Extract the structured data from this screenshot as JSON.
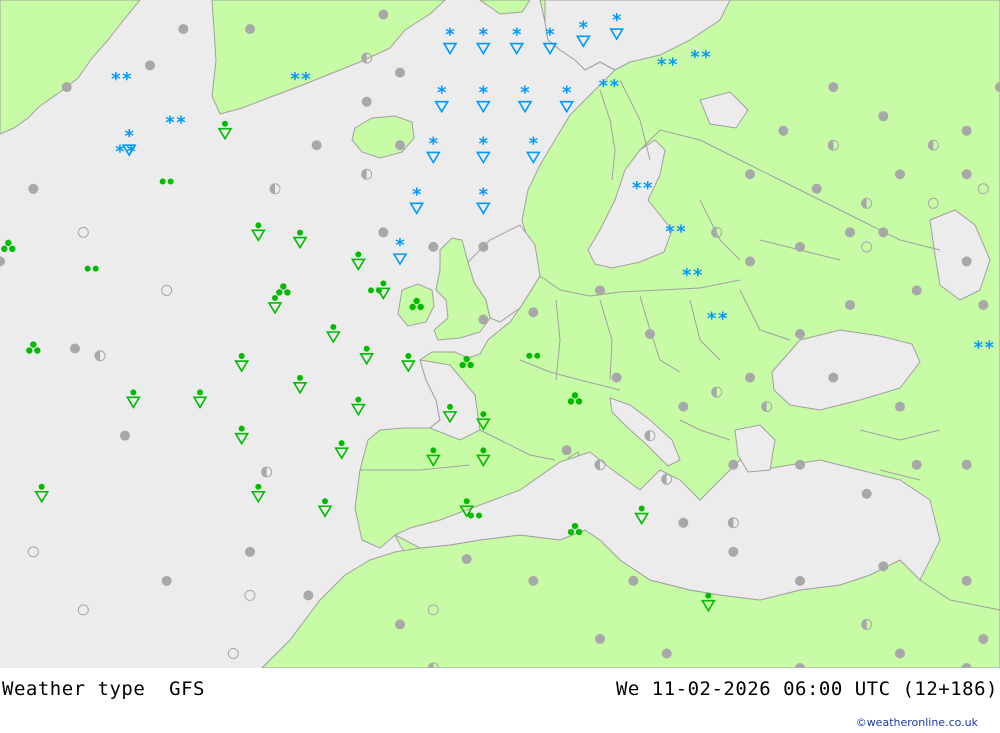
{
  "title": {
    "product": "Weather type",
    "model": "GFS",
    "valid": "We 11-02-2026 06:00 UTC (12+186)"
  },
  "credit": "©weatheronline.co.uk",
  "colors": {
    "sea": "#ececec",
    "land": "#c8fba6",
    "border": "#a0a0a0",
    "rain": "#00bb00",
    "snow": "#0099ff",
    "cloud": "#a8a8a8"
  },
  "symbols": [
    {
      "type": "snow2",
      "lon": -45.5,
      "lat": 70.5
    },
    {
      "type": "snow2",
      "lon": -39,
      "lat": 67.5
    },
    {
      "type": "snow2",
      "lon": -45,
      "lat": 65.5
    },
    {
      "type": "snow",
      "lon": -44.5,
      "lat": 66
    },
    {
      "type": "snow2",
      "lon": -24,
      "lat": 70.5
    },
    {
      "type": "snow",
      "lon": -6,
      "lat": 73
    },
    {
      "type": "snow",
      "lon": -2,
      "lat": 73
    },
    {
      "type": "snow",
      "lon": 2,
      "lat": 73
    },
    {
      "type": "snow",
      "lon": 6,
      "lat": 73
    },
    {
      "type": "snow",
      "lon": 10,
      "lat": 73.5
    },
    {
      "type": "snow",
      "lon": 14,
      "lat": 74
    },
    {
      "type": "snow2",
      "lon": 20,
      "lat": 71.5
    },
    {
      "type": "snow2",
      "lon": 24,
      "lat": 72
    },
    {
      "type": "snow2",
      "lon": 13,
      "lat": 70
    },
    {
      "type": "snow",
      "lon": -7,
      "lat": 69
    },
    {
      "type": "snow",
      "lon": -2,
      "lat": 69
    },
    {
      "type": "snow",
      "lon": 3,
      "lat": 69
    },
    {
      "type": "snow",
      "lon": 8,
      "lat": 69
    },
    {
      "type": "snow",
      "lon": -8,
      "lat": 65.5
    },
    {
      "type": "snow",
      "lon": -2,
      "lat": 65.5
    },
    {
      "type": "snow",
      "lon": 4,
      "lat": 65.5
    },
    {
      "type": "snow",
      "lon": -10,
      "lat": 62
    },
    {
      "type": "snow",
      "lon": -2,
      "lat": 62
    },
    {
      "type": "snow",
      "lon": -12,
      "lat": 58.5
    },
    {
      "type": "snow2",
      "lon": 17,
      "lat": 63
    },
    {
      "type": "snow2",
      "lon": 21,
      "lat": 60
    },
    {
      "type": "snow2",
      "lon": 23,
      "lat": 57
    },
    {
      "type": "snow2",
      "lon": 26,
      "lat": 54
    },
    {
      "type": "snow2",
      "lon": 58,
      "lat": 52
    },
    {
      "type": "rain",
      "lon": -33,
      "lat": 67
    },
    {
      "type": "rain",
      "lon": -29,
      "lat": 60
    },
    {
      "type": "rain",
      "lon": -24,
      "lat": 59.5
    },
    {
      "type": "rain",
      "lon": -17,
      "lat": 58
    },
    {
      "type": "rain",
      "lon": -14,
      "lat": 56
    },
    {
      "type": "rain",
      "lon": -27,
      "lat": 55
    },
    {
      "type": "rain",
      "lon": -20,
      "lat": 53
    },
    {
      "type": "rain",
      "lon": -16,
      "lat": 51.5
    },
    {
      "type": "rain",
      "lon": -31,
      "lat": 51
    },
    {
      "type": "rain",
      "lon": -24,
      "lat": 49.5
    },
    {
      "type": "rain",
      "lon": -44,
      "lat": 48.5
    },
    {
      "type": "rain",
      "lon": -36,
      "lat": 48.5
    },
    {
      "type": "rain",
      "lon": -17,
      "lat": 48
    },
    {
      "type": "rain",
      "lon": -31,
      "lat": 46
    },
    {
      "type": "rain",
      "lon": -19,
      "lat": 45
    },
    {
      "type": "rain",
      "lon": -11,
      "lat": 51
    },
    {
      "type": "rain",
      "lon": -6,
      "lat": 47.5
    },
    {
      "type": "rain",
      "lon": -2,
      "lat": 47
    },
    {
      "type": "rain",
      "lon": -8,
      "lat": 44.5
    },
    {
      "type": "rain",
      "lon": -2,
      "lat": 44.5
    },
    {
      "type": "rain",
      "lon": -55,
      "lat": 42
    },
    {
      "type": "rain",
      "lon": -29,
      "lat": 42
    },
    {
      "type": "rain",
      "lon": -21,
      "lat": 41
    },
    {
      "type": "rain",
      "lon": -4,
      "lat": 41
    },
    {
      "type": "rain",
      "lon": 17,
      "lat": 40.5
    },
    {
      "type": "rain",
      "lon": 25,
      "lat": 34.5
    },
    {
      "type": "rain3",
      "lon": -59,
      "lat": 59
    },
    {
      "type": "rain3",
      "lon": -26,
      "lat": 56
    },
    {
      "type": "rain3",
      "lon": -10,
      "lat": 55
    },
    {
      "type": "rain3",
      "lon": -56,
      "lat": 52
    },
    {
      "type": "rain3",
      "lon": -4,
      "lat": 51
    },
    {
      "type": "rain3",
      "lon": 9,
      "lat": 48.5
    },
    {
      "type": "rain3",
      "lon": 9,
      "lat": 39.5
    },
    {
      "type": "rain2",
      "lon": -40,
      "lat": 63.5
    },
    {
      "type": "rain2",
      "lon": -49,
      "lat": 57.5
    },
    {
      "type": "rain2",
      "lon": -15,
      "lat": 56
    },
    {
      "type": "rain2",
      "lon": 4,
      "lat": 51.5
    },
    {
      "type": "rain2",
      "lon": -3,
      "lat": 40.5
    },
    {
      "type": "cloud",
      "lon": -14,
      "lat": 75
    },
    {
      "type": "cloud",
      "lon": -12,
      "lat": 71
    },
    {
      "type": "cloud",
      "lon": -16,
      "lat": 69
    },
    {
      "type": "cloud",
      "lon": -12,
      "lat": 66
    },
    {
      "type": "cloud",
      "lon": -22,
      "lat": 66
    },
    {
      "type": "cloud",
      "lon": -42,
      "lat": 71.5
    },
    {
      "type": "cloud",
      "lon": -52,
      "lat": 70
    },
    {
      "type": "cloud",
      "lon": -56,
      "lat": 63
    },
    {
      "type": "cloud",
      "lon": -60,
      "lat": 58
    },
    {
      "type": "cloud",
      "lon": -51,
      "lat": 52
    },
    {
      "type": "cloud",
      "lon": -45,
      "lat": 46
    },
    {
      "type": "cloud",
      "lon": -61,
      "lat": 45
    },
    {
      "type": "cloud",
      "lon": -30,
      "lat": 38
    },
    {
      "type": "cloud",
      "lon": -40,
      "lat": 36
    },
    {
      "type": "cloud",
      "lon": -23,
      "lat": 35
    },
    {
      "type": "cloud",
      "lon": -12,
      "lat": 33
    },
    {
      "type": "cloud",
      "lon": -2,
      "lat": 54
    },
    {
      "type": "cloud",
      "lon": -2,
      "lat": 59
    },
    {
      "type": "cloud",
      "lon": 4,
      "lat": 54.5
    },
    {
      "type": "cloud",
      "lon": 12,
      "lat": 56
    },
    {
      "type": "cloud",
      "lon": 18,
      "lat": 53
    },
    {
      "type": "cloud",
      "lon": 30,
      "lat": 58
    },
    {
      "type": "cloud",
      "lon": 36,
      "lat": 59
    },
    {
      "type": "cloud",
      "lon": 42,
      "lat": 60
    },
    {
      "type": "cloud",
      "lon": 30,
      "lat": 64
    },
    {
      "type": "cloud",
      "lon": 38,
      "lat": 63
    },
    {
      "type": "cloud",
      "lon": 48,
      "lat": 64
    },
    {
      "type": "cloud",
      "lon": 34,
      "lat": 67
    },
    {
      "type": "cloud",
      "lon": 46,
      "lat": 68
    },
    {
      "type": "cloud",
      "lon": 40,
      "lat": 70
    },
    {
      "type": "cloud",
      "lon": 56,
      "lat": 64
    },
    {
      "type": "cloud",
      "lon": 46,
      "lat": 60
    },
    {
      "type": "cloud",
      "lon": 50,
      "lat": 56
    },
    {
      "type": "cloud",
      "lon": 42,
      "lat": 55
    },
    {
      "type": "cloud",
      "lon": 36,
      "lat": 53
    },
    {
      "type": "cloud",
      "lon": 56,
      "lat": 58
    },
    {
      "type": "cloud",
      "lon": 58,
      "lat": 55
    },
    {
      "type": "cloud",
      "lon": 30,
      "lat": 50
    },
    {
      "type": "cloud",
      "lon": 40,
      "lat": 50
    },
    {
      "type": "cloud",
      "lon": 48,
      "lat": 48
    },
    {
      "type": "cloud",
      "lon": 22,
      "lat": 48
    },
    {
      "type": "cloud",
      "lon": 14,
      "lat": 50
    },
    {
      "type": "cloud",
      "lon": 8,
      "lat": 45
    },
    {
      "type": "cloud",
      "lon": 28,
      "lat": 44
    },
    {
      "type": "cloud",
      "lon": 36,
      "lat": 44
    },
    {
      "type": "cloud",
      "lon": 44,
      "lat": 42
    },
    {
      "type": "cloud",
      "lon": 50,
      "lat": 44
    },
    {
      "type": "cloud",
      "lon": 56,
      "lat": 44
    },
    {
      "type": "cloud",
      "lon": 22,
      "lat": 40
    },
    {
      "type": "cloud",
      "lon": 28,
      "lat": 38
    },
    {
      "type": "cloud",
      "lon": 36,
      "lat": 36
    },
    {
      "type": "cloud",
      "lon": 46,
      "lat": 37
    },
    {
      "type": "cloud",
      "lon": 56,
      "lat": 36
    },
    {
      "type": "cloud",
      "lon": 16,
      "lat": 36
    },
    {
      "type": "cloud",
      "lon": 4,
      "lat": 36
    },
    {
      "type": "cloud",
      "lon": -4,
      "lat": 37.5
    },
    {
      "type": "cloud",
      "lon": 12,
      "lat": 32
    },
    {
      "type": "cloud",
      "lon": 20,
      "lat": 31
    },
    {
      "type": "cloud",
      "lon": 36,
      "lat": 30
    },
    {
      "type": "cloud",
      "lon": 48,
      "lat": 31
    },
    {
      "type": "cloud",
      "lon": 58,
      "lat": 32
    },
    {
      "type": "cloud",
      "lon": 56,
      "lat": 30
    },
    {
      "type": "cloud",
      "lon": -14,
      "lat": 60
    },
    {
      "type": "cloud",
      "lon": -8,
      "lat": 59
    },
    {
      "type": "cloud",
      "lon": 56,
      "lat": 67
    },
    {
      "type": "cloud",
      "lon": 60,
      "lat": 70
    },
    {
      "type": "cloud",
      "lon": -30,
      "lat": 74
    },
    {
      "type": "cloud",
      "lon": -38,
      "lat": 74
    },
    {
      "type": "half",
      "lon": -27,
      "lat": 63
    },
    {
      "type": "half",
      "lon": -16,
      "lat": 64
    },
    {
      "type": "half",
      "lon": -48,
      "lat": 51.5
    },
    {
      "type": "half",
      "lon": -28,
      "lat": 43.5
    },
    {
      "type": "half",
      "lon": 20,
      "lat": 43
    },
    {
      "type": "half",
      "lon": 28,
      "lat": 40
    },
    {
      "type": "half",
      "lon": 12,
      "lat": 44
    },
    {
      "type": "half",
      "lon": 18,
      "lat": 46
    },
    {
      "type": "half",
      "lon": 26,
      "lat": 49
    },
    {
      "type": "half",
      "lon": 32,
      "lat": 48
    },
    {
      "type": "half",
      "lon": 44,
      "lat": 62
    },
    {
      "type": "half",
      "lon": 40,
      "lat": 66
    },
    {
      "type": "half",
      "lon": 52,
      "lat": 66
    },
    {
      "type": "half",
      "lon": 26,
      "lat": 60
    },
    {
      "type": "half",
      "lon": -8,
      "lat": 30
    },
    {
      "type": "half",
      "lon": 14,
      "lat": 28
    },
    {
      "type": "half",
      "lon": 30,
      "lat": 28
    },
    {
      "type": "half",
      "lon": 44,
      "lat": 33
    },
    {
      "type": "half",
      "lon": -16,
      "lat": 72
    },
    {
      "type": "clear",
      "lon": -50,
      "lat": 60
    },
    {
      "type": "clear",
      "lon": -40,
      "lat": 56
    },
    {
      "type": "clear",
      "lon": -56,
      "lat": 38
    },
    {
      "type": "clear",
      "lon": -50,
      "lat": 34
    },
    {
      "type": "clear",
      "lon": -30,
      "lat": 35
    },
    {
      "type": "clear",
      "lon": -32,
      "lat": 31
    },
    {
      "type": "clear",
      "lon": -8,
      "lat": 34
    },
    {
      "type": "clear",
      "lon": 44,
      "lat": 59
    },
    {
      "type": "clear",
      "lon": 52,
      "lat": 62
    },
    {
      "type": "clear",
      "lon": 58,
      "lat": 63
    }
  ]
}
